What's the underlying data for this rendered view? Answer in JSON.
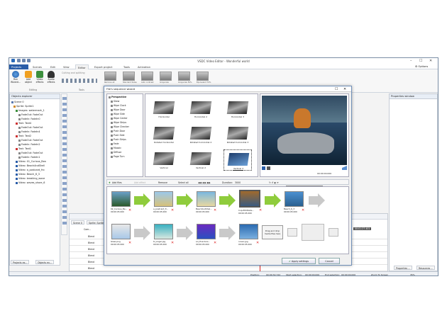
{
  "window": {
    "title": "VSDC Video Editor - Wonderful world",
    "controls": [
      "–",
      "☐",
      "✕"
    ],
    "options": "Options"
  },
  "ribbon_tabs": [
    "Projects",
    "Scenes",
    "Edit",
    "View",
    "Editor",
    "Export project",
    "Tools",
    "Activation"
  ],
  "ribbon": {
    "run_wizard": "Run Wizard...",
    "add_object": "Add object",
    "video_effects": "Video effects",
    "audio_effects": "Audio effects",
    "cutting_label": "Cutting and splitting",
    "group_editing": "Editing",
    "group_tools": "Tools",
    "effect_thumbs": [
      "Remove all",
      "Standard fades",
      "Auto contrast",
      "Grayscale",
      "Grayscale 50%",
      "Equivalent 70%"
    ]
  },
  "objects_explorer": {
    "title": "Objects explorer",
    "items": [
      {
        "label": "Scene 0",
        "indent": 0
      },
      {
        "label": "Sprite: Sprite1",
        "indent": 1
      },
      {
        "label": "Images: watermark_1",
        "indent": 2
      },
      {
        "label": "FadeOut: FadeOut",
        "indent": 3
      },
      {
        "label": "FadeIn: FadeIn0",
        "indent": 3
      },
      {
        "label": "Text: Text4",
        "indent": 2
      },
      {
        "label": "FadeOut: FadeOut",
        "indent": 3
      },
      {
        "label": "FadeIn: FadeIn4",
        "indent": 3
      },
      {
        "label": "Text: Text2",
        "indent": 2
      },
      {
        "label": "FadeOut: FadeOut",
        "indent": 3
      },
      {
        "label": "FadeIn: FadeIn2",
        "indent": 3
      },
      {
        "label": "Text: Text1",
        "indent": 2
      },
      {
        "label": "FadeOut: FadeOut",
        "indent": 3
      },
      {
        "label": "FadeIn: FadeIn1",
        "indent": 3
      },
      {
        "label": "Video: 01_Curious_Bea",
        "indent": 2
      },
      {
        "label": "Video: BeachAndShell",
        "indent": 2
      },
      {
        "label": "Video: a_postcard_fro",
        "indent": 2
      },
      {
        "label": "Video: Beach_6_3",
        "indent": 2
      },
      {
        "label": "Video: breaking_wave",
        "indent": 2
      },
      {
        "label": "Video: waves_shore_6",
        "indent": 2
      }
    ],
    "tabs": [
      "Projects ex...",
      "Objects ex..."
    ]
  },
  "properties": {
    "title": "Properties window",
    "tabs": [
      "Properties ...",
      "Resources ..."
    ]
  },
  "dialog": {
    "title": "File's sequence wizard",
    "categories": [
      "Perspective",
      "Skew",
      "Wipe Clock",
      "Wipe Door",
      "Wipe Side",
      "Wipe Center",
      "Wipe Strips",
      "Wipe Checker",
      "Push Door",
      "Push Side",
      "Push Strips",
      "Fade",
      "Mosaic",
      "Diffuse",
      "Page Turn"
    ],
    "transitions": [
      "Horizontal",
      "Horizontal 2",
      "Horizontal 3",
      "Rotated horizontal",
      "Rotated horizontal 2",
      "Rotated horizontal 3",
      "Vertical",
      "Vertical 2",
      "Vertical 3"
    ],
    "preview_time": "00:00:00.000",
    "toolbar": {
      "add_files": "Add files",
      "add_effect": "Add effect",
      "remove": "Remove",
      "select_all": "Select all",
      "duration_label": "Duration:",
      "duration_value": "3000"
    },
    "tooltip": "Rotate 90 degrees clockwise",
    "clips_row1": [
      "02_Curious_Be...",
      "a_postcard_fr...",
      "BeachAndShel...",
      "Cup-PDC8e4e...",
      "Beach_6_3"
    ],
    "times_row1": [
      "00:00:05.000",
      "00:00:05.000",
      "00:00:05.000",
      "00:00:05.000",
      "00:00:05.000"
    ],
    "clips_row2": [
      "Glass.png",
      "bl_Angel.jpg",
      "ed_thunders...",
      "ocean.jpg"
    ],
    "times_row2": [
      "00:00:05.000",
      "00:00:05.000",
      "00:00:05.000",
      "00:00:05.000"
    ],
    "drag_hint": "Drag and drop media files here",
    "apply": "Apply settings",
    "cancel": "Cancel"
  },
  "timeline": {
    "tabs": [
      "Scene 0",
      "Sprite: Sprite1"
    ],
    "col_header": "Com...",
    "tracks": [
      "Blend",
      "Blend",
      "Blend",
      "Blend",
      "Blend",
      "Blend"
    ],
    "video_label": "Video",
    "clip_label": "Beach_6_3",
    "timecode": "00:01:27.401"
  },
  "status": {
    "position": "Position:",
    "position_val": "00:00:32.722",
    "start_sel": "Start selection:",
    "start_val": "00:00:00.000",
    "end_sel": "End selection:",
    "end_val": "00:00:00.000",
    "zoom": "Zoom To Screen",
    "zoom_pct": "35%"
  },
  "colors": {
    "accent": "#2a5da8",
    "green_arrow": "#8fcc3c",
    "timeline_clip": "#6c8fd6"
  }
}
